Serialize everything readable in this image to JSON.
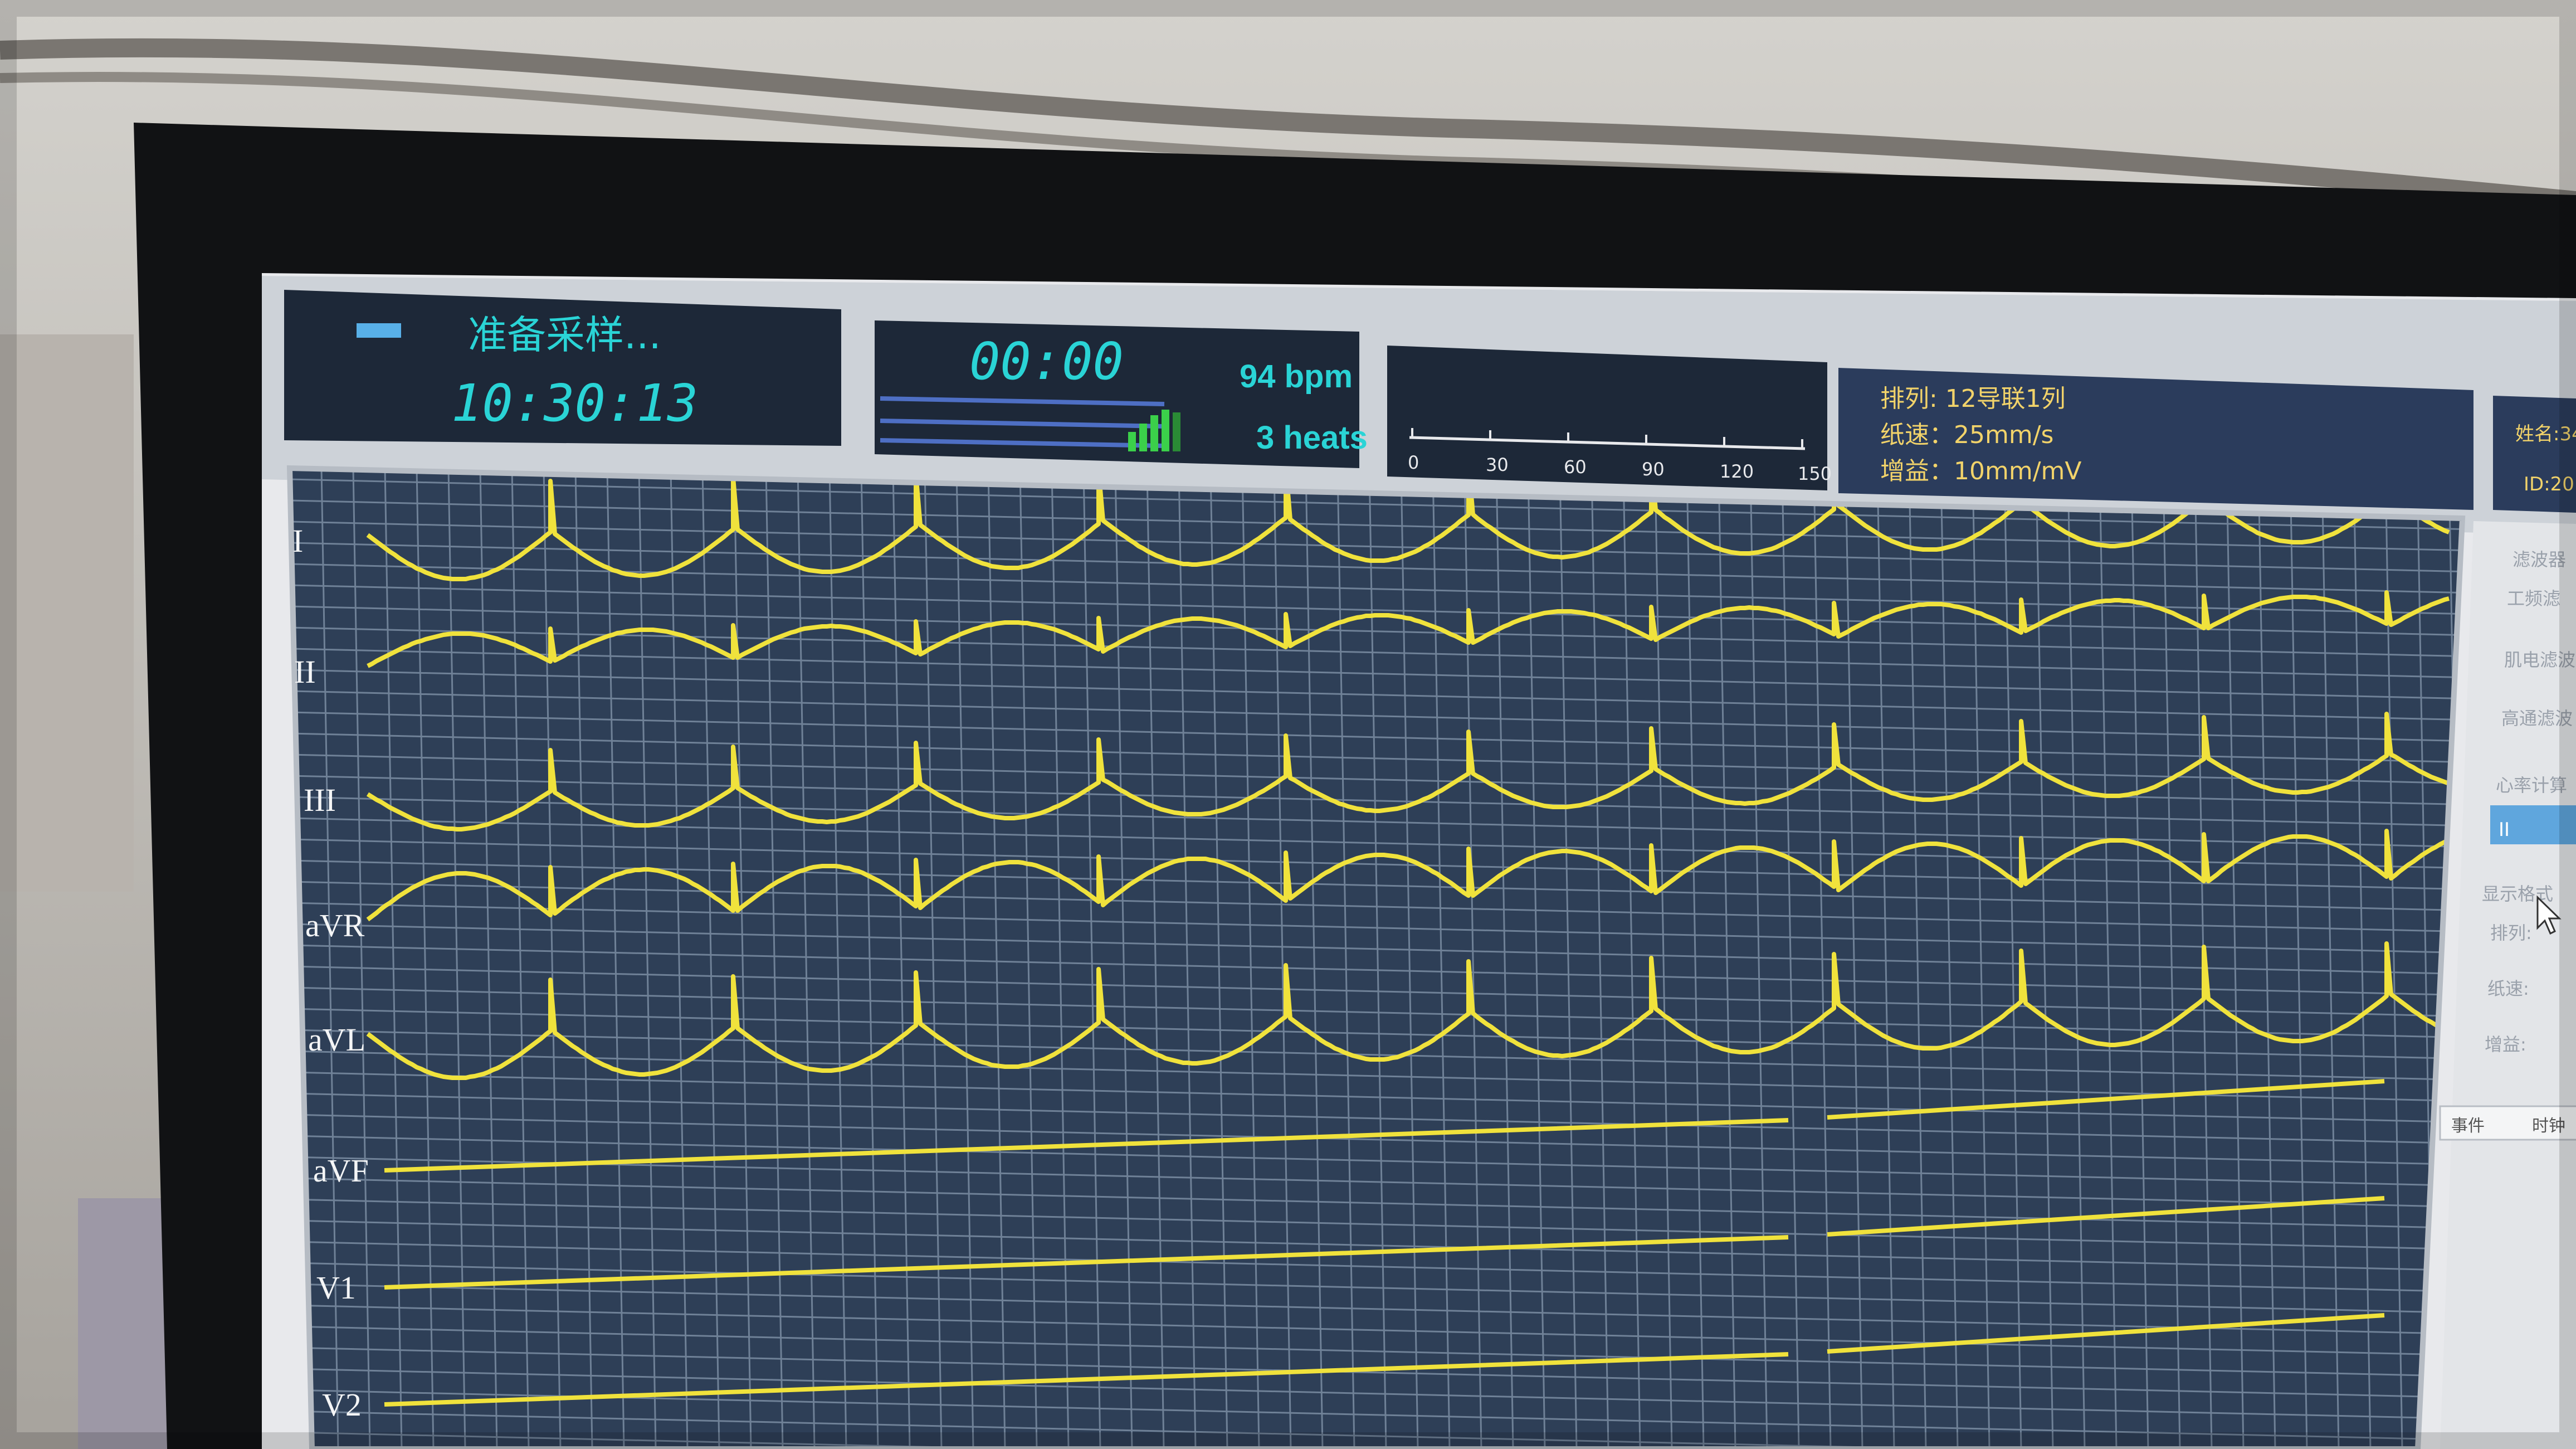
{
  "status": {
    "state_text": "准备采样...",
    "clock": "10:30:13"
  },
  "timer": {
    "elapsed": "00:00",
    "heart_rate": "94 bpm",
    "beats": "3 heats"
  },
  "scale": {
    "ticks": [
      "0",
      "30",
      "60",
      "90",
      "120",
      "150"
    ]
  },
  "settings": {
    "layout": "排列: 12导联1列",
    "paper_speed": "纸速：25mm/s",
    "gain": "增益：10mm/mV"
  },
  "patient": {
    "name": "姓名:34",
    "id": "ID:20"
  },
  "side_panel": {
    "filter": "滤波器",
    "power_filter": "工频滤",
    "emg_filter": "肌电滤波",
    "hp_filter": "高通滤波",
    "hr_calc": "心率计算",
    "hr_value": "II",
    "display_format": "显示格式",
    "arrange": "排列:",
    "speed": "纸速:",
    "gain": "增益:",
    "event_col": "事件",
    "time_col": "时钟"
  },
  "leads": [
    "I",
    "II",
    "III",
    "aVR",
    "aVL",
    "aVF",
    "V1",
    "V2"
  ],
  "colors": {
    "trace": "#f0e23c",
    "teal_text": "#2ad4d6",
    "grid_line": "#6f8197",
    "grid_bg": "#2e3f57",
    "panel_bg": "#1d2838",
    "settings_text": "#f2d36a"
  }
}
